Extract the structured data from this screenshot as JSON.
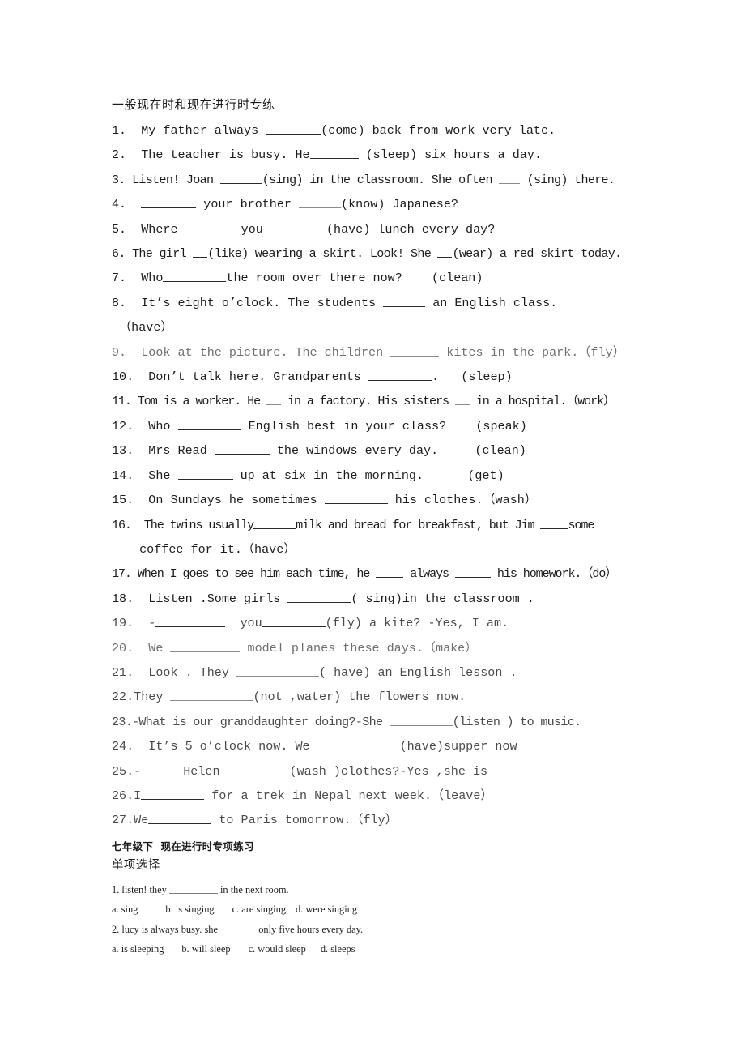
{
  "document": {
    "title": "一般现在时和现在进行时专练",
    "exercises": [
      {
        "n": "1.",
        "pre": "  My father always ",
        "blank": 8,
        "post": "(come) back from work very late."
      },
      {
        "n": "2.",
        "pre": "  The teacher is busy. He",
        "blank": 7,
        "post": " (sleep) six hours a day."
      },
      {
        "n": "3.",
        "pre": " Listen! Joan ",
        "blank": 6,
        "post": "(sing) in the classroom. She often ___ (sing) there."
      },
      {
        "n": "4.",
        "pre": "  ",
        "blank": 8,
        "post": " your brother ______(know) Japanese?"
      },
      {
        "n": "5.",
        "pre": "  Where",
        "blank": 7,
        "post": "  you _______ (have) lunch every day?"
      },
      {
        "n": "6.",
        "pre": " The girl __(like) wearing a skirt. Look! She __(wear) a red skirt today.",
        "blank": 0,
        "post": ""
      },
      {
        "n": "7.",
        "pre": "  Who",
        "blank": 9,
        "post": "the room over there now?    (clean)"
      },
      {
        "n": "8.",
        "pre": "  It’s eight o’clock. The students ______ an English class.",
        "blank": 0,
        "post": ""
      },
      {
        "n": "",
        "pre": " （have）",
        "blank": 0,
        "post": ""
      },
      {
        "n": "9.",
        "pre": "  Look at the picture. The children _______ kites in the park.（fly）",
        "blank": 0,
        "post": ""
      },
      {
        "n": "10.",
        "pre": "  Don’t talk here. Grandparents _________.   (sleep)",
        "blank": 0,
        "post": ""
      },
      {
        "n": "11.",
        "pre": " Tom is a worker. He __ in a factory. His sisters __ in a hospital.（work）",
        "blank": 0,
        "post": ""
      },
      {
        "n": "12.",
        "pre": "  Who _________ English best in your class?    (speak)",
        "blank": 0,
        "post": ""
      },
      {
        "n": "13.",
        "pre": "  Mrs Read ________ the windows every day.     (clean)",
        "blank": 0,
        "post": ""
      },
      {
        "n": "14.",
        "pre": "  She ________ up at six in the morning.      (get)",
        "blank": 0,
        "post": ""
      },
      {
        "n": "15.",
        "pre": "  On Sundays he sometimes __________ his clothes.（wash）",
        "blank": 0,
        "post": ""
      },
      {
        "n": "16.",
        "pre": "  The twins usually______milk and bread for breakfast, but Jim ____some",
        "blank": 0,
        "post": ""
      },
      {
        "n": "",
        "pre": "  coffee for it.（have）",
        "blank": 0,
        "post": ""
      },
      {
        "n": "17.",
        "pre": " When I goes to see him each time, he ____ always _____ his homework.（do）",
        "blank": 0,
        "post": ""
      },
      {
        "n": "18.",
        "pre": "  Listen .Some girls __________( sing)in the classroom .",
        "blank": 0,
        "post": ""
      },
      {
        "n": "19.",
        "pre": "  -__________  you_________(fly) a kite? -Yes, I am.",
        "blank": 0,
        "post": ""
      },
      {
        "n": "20.",
        "pre": "  We __________ model planes these days.（make）",
        "blank": 0,
        "post": ""
      },
      {
        "n": "21.",
        "pre": "  Look . They _____________( have) an English lesson .",
        "blank": 0,
        "post": ""
      },
      {
        "n": "22.",
        "pre": "They ____________(not ,water) the flowers now.",
        "blank": 0,
        "post": ""
      },
      {
        "n": "23.",
        "pre": "-What is our granddaughter doing?-She _________(listen ) to music.",
        "blank": 0,
        "post": ""
      },
      {
        "n": "24.",
        "pre": "  It’s 5 o’clock now. We ____________(have)supper now",
        "blank": 0,
        "post": ""
      },
      {
        "n": "25.",
        "pre": "-______Helen__________(wash )clothes?-Yes ,she is",
        "blank": 0,
        "post": ""
      },
      {
        "n": "26.",
        "pre": "I_________ for a trek in Nepal next week.（leave）",
        "blank": 0,
        "post": ""
      },
      {
        "n": "27.",
        "pre": "We_________ to Paris tomorrow.（fly）",
        "blank": 0,
        "post": ""
      }
    ],
    "section_heading": "七年级下  现在进行时专项练习",
    "section_subheading": "单项选择",
    "mc_questions": [
      {
        "stem_pre": "1. listen! they ",
        "stem_blank": 8,
        "stem_post": " in the next room.",
        "options": [
          "a. sing",
          "b. is singing",
          "c. are singing",
          "d. were singing"
        ]
      },
      {
        "stem_pre": "2. lucy is always busy. she ",
        "stem_blank": 6,
        "stem_post": " only five hours every day.",
        "options": [
          "a. is sleeping",
          "b. will sleep",
          "c. would sleep",
          "d. sleeps"
        ]
      }
    ]
  },
  "lines": {
    "l1": "1.  My father always ",
    "l1b": "(come) back from work very late.",
    "l2": "2.  The teacher is busy. He",
    "l2b": " (sleep) six hours a day.",
    "l3": "3. Listen! Joan ",
    "l3b": "(sing) in the classroom. She often ",
    "l3c": " (sing) there.",
    "l4": "4.  ",
    "l4b": " your brother ",
    "l4c": "(know) Japanese?",
    "l5": "5.  Where",
    "l5b": "  you ",
    "l5c": " (have) lunch every day?",
    "l6": "6. The girl ",
    "l6b": "(like) wearing a skirt. Look! She ",
    "l6c": "(wear) a red skirt today.",
    "l7": "7.  Who",
    "l7b": "the room over there now?    (clean)",
    "l8": "8.  It’s eight o’clock. The students ",
    "l8b": " an English class.",
    "l8c": " （have）",
    "l9": "9.  Look at the picture. The children ",
    "l9b": " kites in the park.（fly）",
    "l10": "10.  Don’t talk here. Grandparents ",
    "l10b": ".   (sleep)",
    "l11": "11. Tom is a worker. He ",
    "l11b": " in a factory. His sisters ",
    "l11c": " in a hospital.（work）",
    "l12": "12.  Who ",
    "l12b": " English best in your class?    (speak)",
    "l13": "13.  Mrs Read ",
    "l13b": " the windows every day.     (clean)",
    "l14": "14.  She ",
    "l14b": " up at six in the morning.      (get)",
    "l15": "15.  On Sundays he sometimes ",
    "l15b": " his clothes.（wash）",
    "l16": "16.  The twins usually",
    "l16b": "milk and bread for breakfast, but Jim ",
    "l16c": "some",
    "l16d": "  coffee for it.（have）",
    "l17": "17. When I goes to see him each time, he ",
    "l17b": " always ",
    "l17c": " his homework.（do）",
    "l18": "18.  Listen .Some girls ",
    "l18b": "( sing)in the classroom .",
    "l19": "19.  -",
    "l19b": "  you",
    "l19c": "(fly) a kite? -Yes, I am.",
    "l20": "20.  We ",
    "l20b": " model planes these days.（make）",
    "l21": "21.  Look . They ",
    "l21b": "( have) an English lesson .",
    "l22": "22.They ",
    "l22b": "(not ,water) the flowers now.",
    "l23": "23.-What is our granddaughter doing?-She ",
    "l23b": "(listen ) to music.",
    "l24": "24.  It’s 5 o’clock now. We ",
    "l24b": "(have)supper now",
    "l25": "25.-",
    "l25b": "Helen",
    "l25c": "(wash )clothes?-Yes ,she is",
    "l26": "26.I",
    "l26b": " for a trek in Nepal next week.（leave）",
    "l27": "27.We",
    "l27b": " to Paris tomorrow.（fly）"
  },
  "mc": {
    "q1_pre": "1. listen! they ",
    "q1_post": " in the next room.",
    "q1_a": "a. sing",
    "q1_b": "b. is singing",
    "q1_c": "c. are singing",
    "q1_d": "d. were singing",
    "q2_pre": "2. lucy is always busy. she ",
    "q2_post": " only five hours every day.",
    "q2_a": "a. is sleeping",
    "q2_b": "b. will sleep",
    "q2_c": "c. would sleep",
    "q2_d": "d. sleeps"
  },
  "colors": {
    "text": "#1c1c1c",
    "gray_text": "#6f6f6f",
    "mid_text": "#4a4a4a",
    "rule": "#2b2b2b",
    "background": "#ffffff"
  }
}
